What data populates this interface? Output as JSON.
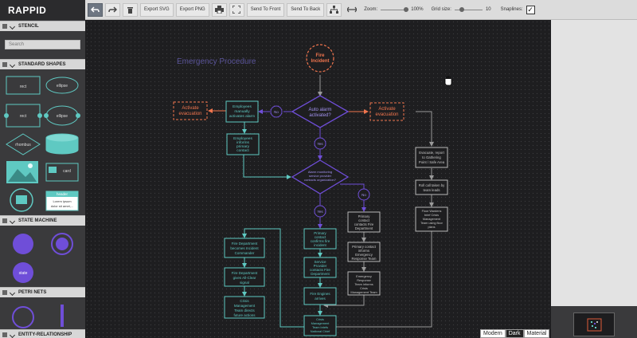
{
  "app": {
    "brand": "RAPPID"
  },
  "stencil": {
    "title": "STENCIL",
    "search_placeholder": "Search",
    "groups": {
      "standard": "STANDARD SHAPES",
      "state": "STATE MACHINE",
      "petri": "PETRI NETS",
      "er": "ENTITY-RELATIONSHIP"
    },
    "shapes": {
      "rect": "rect",
      "ellipse": "ellipse",
      "rhombus": "rhombus",
      "card": "card",
      "header": "header",
      "lorem_line1": "Lorem ipsum",
      "lorem_line2": "dolor sit amet,...",
      "state": "state"
    }
  },
  "toolbar": {
    "export_svg": "Export SVG",
    "export_png": "Export PNG",
    "send_front": "Send To Front",
    "send_back": "Send To Back",
    "zoom_label": "Zoom:",
    "zoom_value": "100%",
    "grid_label": "Grid size:",
    "grid_value": "10",
    "snaplines_label": "Snaplines:",
    "snaplines_checked": "✓",
    "zoom_fraction": 1.0,
    "grid_fraction": 0.2
  },
  "theme": {
    "options": [
      "Modern",
      "Dark",
      "Material"
    ],
    "active": "Dark"
  },
  "diagram": {
    "title": "Emergency Procedure",
    "fire_incident": [
      "Fire",
      "Incident"
    ],
    "activate_evac": [
      "Activate",
      "evacuation"
    ],
    "auto_alarm": [
      "Auto alarm",
      "activated?"
    ],
    "no": "No",
    "yes": "Yes",
    "employees_manually": [
      "Employees",
      "manually",
      "activates alarm"
    ],
    "employees_inform": [
      "Employees",
      "informs",
      "primary",
      "contact"
    ],
    "alarm_monitoring": [
      "Alarm monitoring",
      "service provider",
      "contacts organization?"
    ],
    "evacuate_report": [
      "Evacuate, report",
      "to Gathering",
      "Point / Safe Area"
    ],
    "roll_call": [
      "Roll call taken by",
      "team leads"
    ],
    "floor_wardens": [
      "Floor Wardens",
      "brief Crisis",
      "Management",
      "Team using floor",
      "plans"
    ],
    "primary_contact_contacts": [
      "Primary",
      "contact",
      "contacts Fire",
      "Department"
    ],
    "primary_contact_informs": [
      "Primary contact",
      "informs",
      "Emergency",
      "Response Team"
    ],
    "emergency_response": [
      "Emergency",
      "Response",
      "Team informs",
      "Crisis",
      "Management Team"
    ],
    "primary_confirms": [
      "Primary",
      "contact",
      "confirms fire",
      "incident"
    ],
    "service_provider": [
      "Service",
      "Provider",
      "contacts Fire",
      "Department"
    ],
    "fire_engines": [
      "Fire Engines",
      "arrives"
    ],
    "crisis_mgmt_bottom": [
      "Crisis",
      "Management",
      "Team briefs",
      "National Chief"
    ],
    "fire_dept_commander": [
      "Fire Department",
      "becomes Incident",
      "Commander"
    ],
    "fire_dept_all_clear": [
      "Fire Department",
      "gives All-Clear",
      "signal"
    ],
    "crisis_directs": [
      "Crisis",
      "Management",
      "Team directs",
      "future actions"
    ]
  },
  "colors": {
    "teal": "#5fc9c2",
    "orange": "#f0754e",
    "purple": "#6f4ed8",
    "gray": "#b8b8b8",
    "canvas_bg": "#1e1e20",
    "title_purple": "#5a5499"
  }
}
